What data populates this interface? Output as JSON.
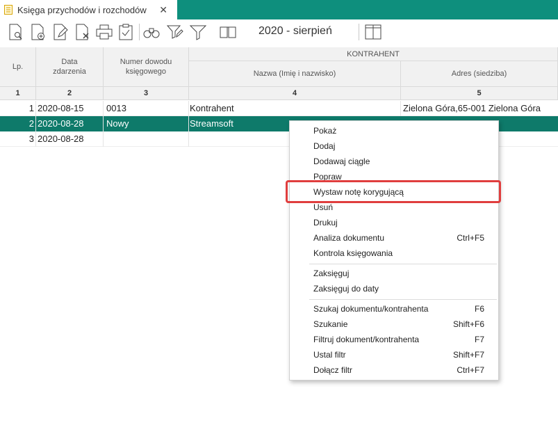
{
  "tab": {
    "title": "Księga przychodów i rozchodów",
    "close": "✕"
  },
  "toolbar": {
    "period": "2020 - sierpień"
  },
  "columns": {
    "lp": "Lp.",
    "data": "Data zdarzenia",
    "numer": "Numer dowodu księgowego",
    "kontrahent": "KONTRAHENT",
    "nazwa": "Nazwa (Imię i nazwisko)",
    "adres": "Adres (siedziba)",
    "numbers": [
      "1",
      "2",
      "3",
      "4",
      "5"
    ]
  },
  "rows": [
    {
      "lp": "1",
      "data": "2020-08-15",
      "numer": "0013",
      "nazwa": "Kontrahent",
      "adres": "Zielona Góra,65-001 Zielona Góra"
    },
    {
      "lp": "2",
      "data": "2020-08-28",
      "numer": "Nowy",
      "nazwa": "Streamsoft",
      "adres": ""
    },
    {
      "lp": "3",
      "data": "2020-08-28",
      "numer": "",
      "nazwa": "",
      "adres": ""
    }
  ],
  "menu": {
    "items": [
      {
        "label": "Pokaż",
        "shortcut": ""
      },
      {
        "label": "Dodaj",
        "shortcut": ""
      },
      {
        "label": "Dodawaj ciągle",
        "shortcut": ""
      },
      {
        "label": "Popraw",
        "shortcut": ""
      },
      {
        "label": "Wystaw notę korygującą",
        "shortcut": ""
      },
      {
        "label": "Usuń",
        "shortcut": ""
      },
      {
        "label": "Drukuj",
        "shortcut": ""
      },
      {
        "label": "Analiza dokumentu",
        "shortcut": "Ctrl+F5"
      },
      {
        "label": "Kontrola księgowania",
        "shortcut": ""
      },
      {
        "label": "Zaksięguj",
        "shortcut": ""
      },
      {
        "label": "Zaksięguj do daty",
        "shortcut": ""
      },
      {
        "label": "Szukaj dokumentu/kontrahenta",
        "shortcut": "F6"
      },
      {
        "label": "Szukanie",
        "shortcut": "Shift+F6"
      },
      {
        "label": "Filtruj dokument/kontrahenta",
        "shortcut": "F7"
      },
      {
        "label": "Ustal filtr",
        "shortcut": "Shift+F7"
      },
      {
        "label": "Dołącz filtr",
        "shortcut": "Ctrl+F7"
      }
    ]
  },
  "colors": {
    "accent": "#0e8f7d",
    "selected_row": "#0e7a6a",
    "highlight": "#e03e3e"
  }
}
